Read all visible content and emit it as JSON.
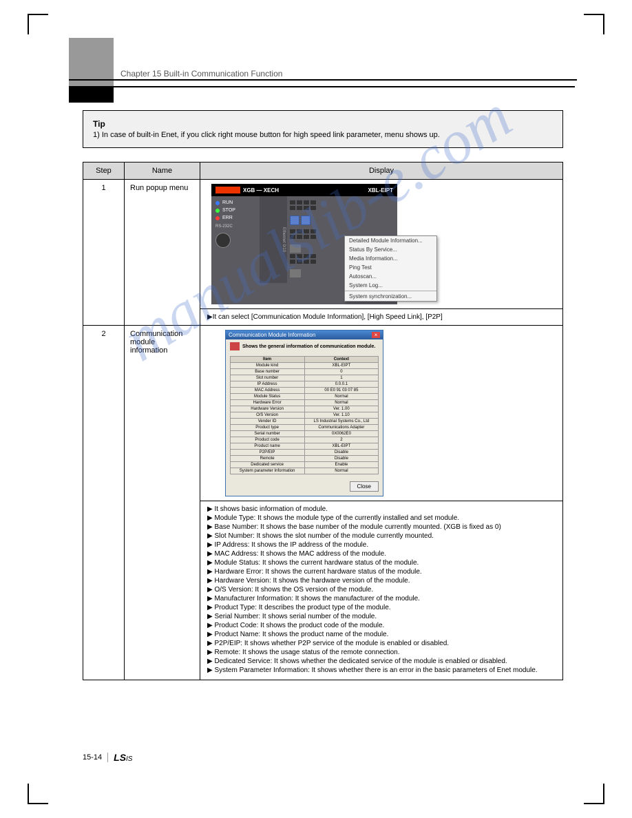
{
  "page_number": "15-14",
  "chapter_title": "Chapter 15 Built-in Communication Function",
  "tip": {
    "label": "Tip",
    "item": "1) In case of built-in Enet, if you click right mouse button for high speed link parameter, menu shows up."
  },
  "table": {
    "headers": {
      "step": "Step",
      "name": "Name",
      "screen": "Display"
    },
    "rows": [
      {
        "step": "1",
        "name": "Run popup menu",
        "desc": "▶It can select [Communication Module Information], [High Speed Link], [P2P]",
        "plc": {
          "top_logo": "XGB — XECH",
          "top_module": "XBL-EIPT",
          "leds": [
            {
              "label": "RUN",
              "color": "#3a7aff"
            },
            {
              "label": "STOP",
              "color": "#3cff3c"
            },
            {
              "label": "ERR",
              "color": "#ff3c3c"
            }
          ],
          "port_label": "RS-232C",
          "col2_labels": [
            "Ethernet 0/10",
            "Ethernet 0/10"
          ],
          "context_menu": [
            "Detailed Module Information...",
            "Status By Service...",
            "Media Information...",
            "Ping Test",
            "Autoscan...",
            "System Log...",
            "System synchronization..."
          ]
        }
      },
      {
        "step": "2",
        "name": "Communication module information",
        "dialog": {
          "title": "Communication Module Information",
          "subtitle": "Shows the general information of communication module.",
          "headers": {
            "item": "Item",
            "context": "Context"
          },
          "items": [
            {
              "item": "Module kind",
              "context": "XBL-EIPT"
            },
            {
              "item": "Base number",
              "context": "0"
            },
            {
              "item": "Slot number",
              "context": "1"
            },
            {
              "item": "IP Address",
              "context": "0.0.0.1"
            },
            {
              "item": "MAC Address",
              "context": "00 E0 91 03 07 85"
            },
            {
              "item": "Module Status",
              "context": "Normal"
            },
            {
              "item": "Hardware Error",
              "context": "Normal"
            },
            {
              "item": "Hardware Version",
              "context": "Ver. 1.00"
            },
            {
              "item": "O/S Version",
              "context": "Ver. 1.10"
            },
            {
              "item": "Vender ID",
              "context": "LS Industrial Systems Co., Ltd"
            },
            {
              "item": "Product type",
              "context": "Communications Adapter"
            },
            {
              "item": "Serial number",
              "context": "0X0062E0"
            },
            {
              "item": "Product code",
              "context": "2"
            },
            {
              "item": "Product name",
              "context": "XBL-EIPT"
            },
            {
              "item": "P2P/EIP",
              "context": "Disable"
            },
            {
              "item": "Remote",
              "context": "Disable"
            },
            {
              "item": "Dedicated service",
              "context": "Enable"
            },
            {
              "item": "System parameter Information",
              "context": "Normal"
            }
          ],
          "close": "Close"
        },
        "desc_lines": [
          "▶ It shows basic information of module.",
          "▶ Module Type: It shows the module type of the currently installed and set module.",
          "▶ Base Number: It shows the base number of the module currently mounted. (XGB is fixed as 0)",
          "▶ Slot Number: It shows the slot number of the module currently mounted.",
          "▶ IP Address: It shows the IP address of the module.",
          "▶ MAC Address: It shows the MAC address of the module.",
          "▶ Module Status: It shows the current hardware status of the module.",
          "▶ Hardware Error: It shows the current hardware status of the module.",
          "▶ Hardware Version: It shows the hardware version of the module.",
          "▶ O/S Version: It shows the OS version of the module.",
          "▶ Manufacturer Information: It shows the manufacturer of the module.",
          "▶ Product Type: It describes the product type of the module.",
          "▶ Serial Number: It shows serial number of the module.",
          "▶ Product Code: It shows the product code of the module.",
          "▶ Product Name: It shows the product name of the module.",
          "▶ P2P/EIP: It shows whether P2P service of the module is enabled or disabled.",
          "▶ Remote: It shows the usage status of the remote connection.",
          "▶ Dedicated Service: It shows whether the dedicated service of the module is enabled or disabled.",
          "▶ System Parameter Information: It shows whether there is an error in the basic parameters of Enet module."
        ]
      }
    ]
  },
  "watermark": "manualslib-e.com",
  "footer": {
    "brand": "LS",
    "sub": "IS"
  }
}
